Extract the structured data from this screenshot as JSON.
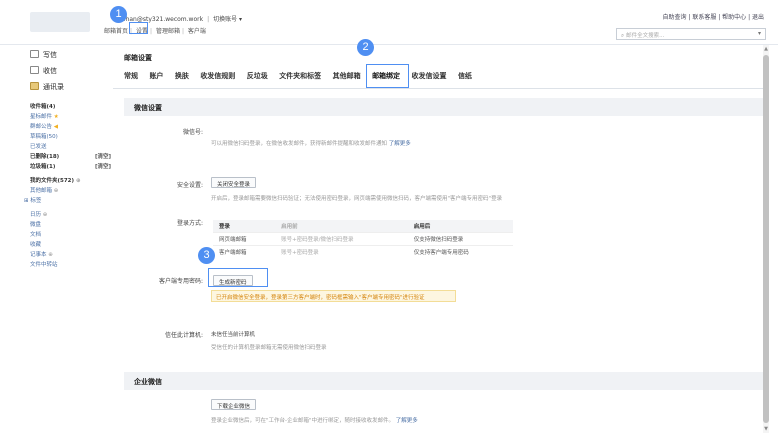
{
  "header": {
    "account": "xiaohan@sty321.wecom.work",
    "switch_account": "切换账号",
    "subnav": [
      "邮箱首页",
      "设置",
      "管理邮箱",
      "客户端"
    ],
    "toplinks": "自助查询 | 联系客服 | 帮助中心 | 退出",
    "search_placeholder": "邮件全文搜索..."
  },
  "sidebar": {
    "write": "写信",
    "inbox_btn": "收信",
    "contacts": "通讯录",
    "items": [
      {
        "label": "收件箱(4)"
      },
      {
        "label": "星标邮件"
      },
      {
        "label": "群邮公告"
      },
      {
        "label": "草稿箱(50)"
      },
      {
        "label": "已发送"
      },
      {
        "label": "已删除(18)",
        "aux": "[清空]"
      },
      {
        "label": "垃圾箱(1)",
        "aux": "[清空]"
      },
      {
        "label": "我的文件夹(572)"
      },
      {
        "label": "其他邮箱"
      },
      {
        "label": "标签"
      },
      {
        "label": "日历"
      },
      {
        "label": "微盘"
      },
      {
        "label": "文档"
      },
      {
        "label": "收藏"
      },
      {
        "label": "记事本"
      },
      {
        "label": "文件中转站"
      }
    ]
  },
  "content": {
    "title": "邮箱设置",
    "tabs": [
      "常规",
      "账户",
      "换肤",
      "收发信规则",
      "反垃圾",
      "文件夹和标签",
      "其他邮箱",
      "邮箱绑定",
      "收发信设置",
      "信纸"
    ],
    "wechat_section": "微信设置",
    "wechat_label": "微信号:",
    "wechat_note": "可以用微信扫码登录，在微信收发邮件，获得新邮件提醒和收发邮件通知",
    "wechat_link": "了解更多",
    "security_label": "安全设置:",
    "security_btn": "关闭安全登录",
    "security_note": "开启后，登录邮箱需要微信扫码验证；无法使用密码登录，网页端需使用微信扫码，客户端需使用\"客户端专用密码\"登录",
    "login_label": "登录方式:",
    "login_table": {
      "headers": [
        "登录",
        "启用前",
        "启用后"
      ],
      "rows": [
        [
          "网页端邮箱",
          "账号+密码登录/微信扫码登录",
          "仅支持微信扫码登录"
        ],
        [
          "客户端邮箱",
          "账号+密码登录",
          "仅支持客户端专用密码"
        ]
      ]
    },
    "client_pwd_label": "客户端专用密码:",
    "client_pwd_btn": "生成新密码",
    "client_pwd_warn": "已开启微信安全登录，登录第三方客户端时，密码框需输入\"客户端专用密码\"进行验证",
    "trusted_label": "信任此计算机:",
    "trusted_value": "未信任当前计算机",
    "trusted_note": "受信任的计算机登录邮箱无需使用微信扫码登录",
    "enterprise_section": "企业微信",
    "enterprise_btn": "下载企业微信",
    "enterprise_note": "登录企业微信后，可在\"工作台-企业邮箱\"中进行绑定，随时接收收发邮件。",
    "enterprise_link": "了解更多"
  },
  "badges": [
    "1",
    "2",
    "3"
  ],
  "colors": {
    "accent": "#4f8ff2",
    "warning_text": "#d4840b",
    "warning_bg": "#fdf6e0"
  }
}
